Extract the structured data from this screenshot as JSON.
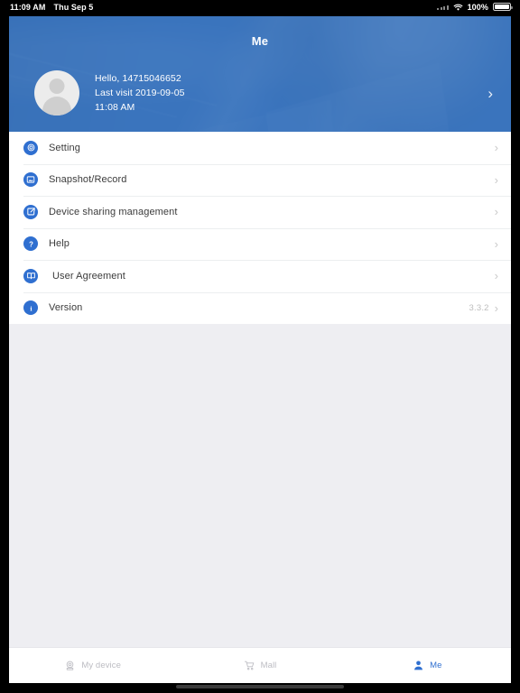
{
  "statusbar": {
    "time": "11:09 AM",
    "date": "Thu Sep 5",
    "wifi_icon": "wifi-icon",
    "battery_percent": "100%",
    "battery_icon": "battery-full-icon"
  },
  "header": {
    "title": "Me",
    "avatar_icon": "avatar-placeholder-icon",
    "greeting": "Hello, 14715046652",
    "last_visit": "Last visit 2019-09-05",
    "last_visit_time": "11:08 AM",
    "chevron_icon": "chevron-right-icon",
    "accent_color": "#3d74bd"
  },
  "menu": {
    "items": [
      {
        "label": "Setting",
        "icon": "gear-icon",
        "value": "",
        "chevron": "chevron-right-icon"
      },
      {
        "label": "Snapshot/Record",
        "icon": "photo-icon",
        "value": "",
        "chevron": "chevron-right-icon"
      },
      {
        "label": "Device sharing management",
        "icon": "share-icon",
        "value": "",
        "chevron": "chevron-right-icon"
      },
      {
        "label": "Help",
        "icon": "question-icon",
        "value": "",
        "chevron": "chevron-right-icon"
      },
      {
        "label": "User Agreement",
        "icon": "book-icon",
        "value": "",
        "chevron": "chevron-right-icon"
      },
      {
        "label": "Version",
        "icon": "info-icon",
        "value": "3.3.2",
        "chevron": "chevron-right-icon"
      }
    ],
    "icon_color": "#2f6fd0"
  },
  "tabbar": {
    "tabs": [
      {
        "label": "My device",
        "icon": "camera-icon",
        "active": false
      },
      {
        "label": "Mall",
        "icon": "cart-icon",
        "active": false
      },
      {
        "label": "Me",
        "icon": "person-icon",
        "active": true
      }
    ],
    "active_color": "#2f6fd0",
    "inactive_color": "#bcbcc2"
  }
}
